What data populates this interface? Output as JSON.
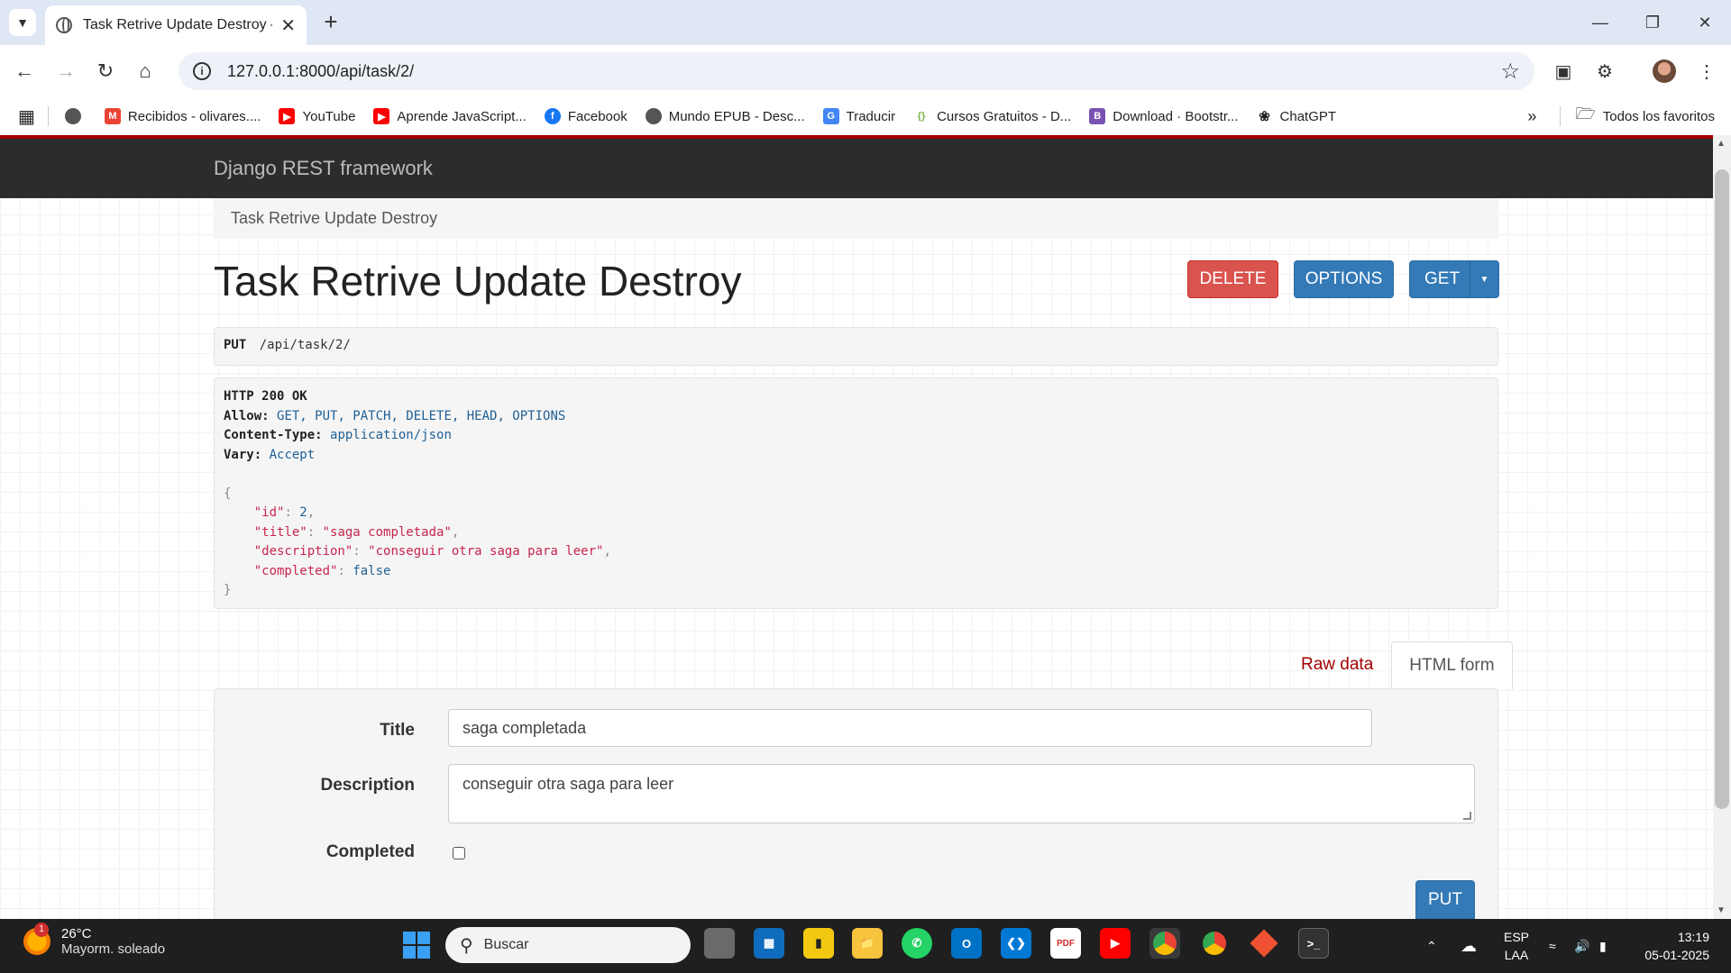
{
  "browser": {
    "tab_title": "Task Retrive Update Destroy – Dj",
    "url": "127.0.0.1:8000/api/task/2/",
    "bookmarks": [
      {
        "label": "Recibidos - olivares....",
        "icon": "gmail-icon",
        "color": "#ea4335"
      },
      {
        "label": "YouTube",
        "icon": "youtube-icon",
        "color": "#ff0000"
      },
      {
        "label": "Aprende JavaScript...",
        "icon": "youtube-icon",
        "color": "#ff0000"
      },
      {
        "label": "Facebook",
        "icon": "facebook-icon",
        "color": "#1877f2"
      },
      {
        "label": "Mundo EPUB - Desc...",
        "icon": "globe-icon",
        "color": "#555555"
      },
      {
        "label": "Traducir",
        "icon": "translate-icon",
        "color": "#4285f4"
      },
      {
        "label": "Cursos Gratuitos - D...",
        "icon": "code-icon",
        "color": "#7cb342"
      },
      {
        "label": "Download · Bootstr...",
        "icon": "bootstrap-icon",
        "color": "#7952b3"
      },
      {
        "label": "ChatGPT",
        "icon": "chatgpt-icon",
        "color": "#222222"
      }
    ],
    "all_bookmarks": "Todos los favoritos"
  },
  "drf": {
    "brand": "Django REST framework",
    "breadcrumb": "Task Retrive Update Destroy",
    "title": "Task Retrive Update Destroy",
    "buttons": {
      "delete": "DELETE",
      "options": "OPTIONS",
      "get": "GET"
    },
    "request": {
      "method": "PUT",
      "path": "/api/task/2/"
    },
    "response": {
      "status": "HTTP 200 OK",
      "headers": [
        {
          "key": "Allow:",
          "value": "GET, PUT, PATCH, DELETE, HEAD, OPTIONS"
        },
        {
          "key": "Content-Type:",
          "value": "application/json"
        },
        {
          "key": "Vary:",
          "value": "Accept"
        }
      ],
      "body": {
        "id": "2",
        "title": "\"saga completada\"",
        "description": "\"conseguir otra saga para leer\"",
        "completed": "false"
      }
    },
    "tabs": {
      "raw": "Raw data",
      "html": "HTML form"
    },
    "form": {
      "title_label": "Title",
      "title_value": "saga completada",
      "description_label": "Description",
      "description_value": "conseguir otra saga para leer",
      "completed_label": "Completed",
      "completed_checked": false,
      "submit": "PUT"
    }
  },
  "taskbar": {
    "temperature": "26°C",
    "weather": "Mayorm. soleado",
    "weather_badge": "1",
    "search_placeholder": "Buscar",
    "lang_1": "ESP",
    "lang_2": "LAA",
    "time": "13:19",
    "date": "05-01-2025"
  },
  "colors": {
    "delete": "#d9534f",
    "primary": "#337ab7",
    "nav": "#2c2c2c",
    "accent": "#a30000"
  }
}
